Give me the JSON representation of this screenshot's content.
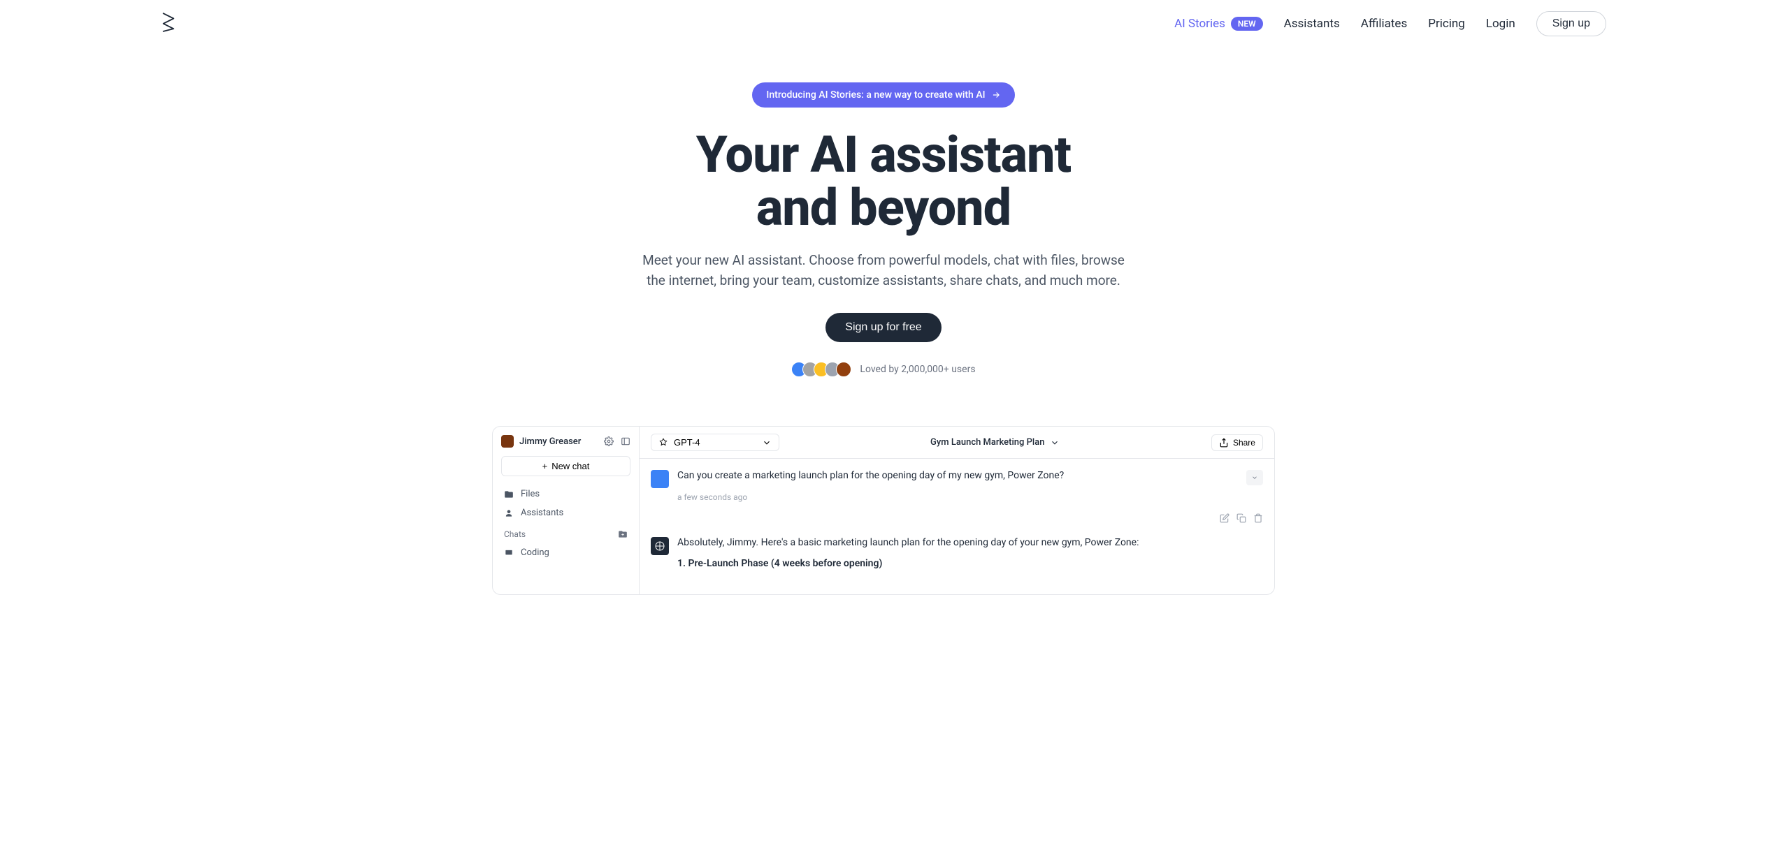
{
  "nav": {
    "links": {
      "ai_stories": "AI Stories",
      "new_badge": "NEW",
      "assistants": "Assistants",
      "affiliates": "Affiliates",
      "pricing": "Pricing",
      "login": "Login",
      "signup": "Sign up"
    }
  },
  "hero": {
    "announcement": "Introducing AI Stories: a new way to create with AI",
    "title_line1": "Your AI assistant",
    "title_line2": "and beyond",
    "subtitle": "Meet your new AI assistant. Choose from powerful models, chat with files, browse the internet, bring your team, customize assistants, share chats, and much more.",
    "cta": "Sign up for free",
    "social_proof": "Loved by 2,000,000+ users"
  },
  "app": {
    "user_name": "Jimmy Greaser",
    "new_chat": "New chat",
    "files": "Files",
    "assistants": "Assistants",
    "chats_section": "Chats",
    "chat_coding": "Coding",
    "model": "GPT-4",
    "chat_title": "Gym Launch Marketing Plan",
    "share": "Share",
    "user_message": "Can you create a marketing launch plan for the opening day of my new gym, Power Zone?",
    "timestamp": "a few seconds ago",
    "ai_intro": "Absolutely, Jimmy. Here's a basic marketing launch plan for the opening day of your new gym, Power Zone:",
    "ai_phase": "1. Pre-Launch Phase (4 weeks before opening)"
  }
}
